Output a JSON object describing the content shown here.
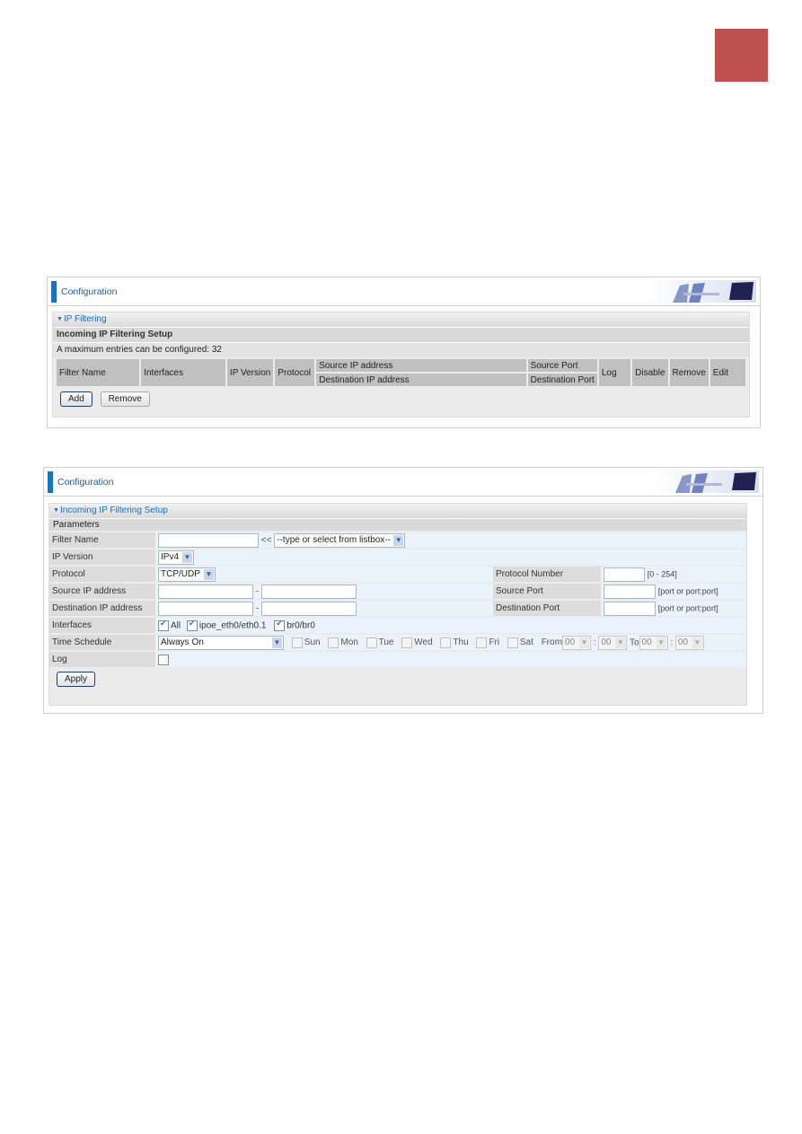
{
  "colors": {
    "accent": "#1276c3",
    "red_tab": "#c0504d",
    "title_blue": "#1a5fa0"
  },
  "panel1": {
    "header_title": "Configuration",
    "banner_icon": "office-chairs-monitor-banner",
    "section_title": "IP Filtering",
    "subtitle": "Incoming IP Filtering Setup",
    "max_entries_text": "A maximum entries can be configured: 32",
    "columns": {
      "filter_name": "Filter Name",
      "interfaces": "Interfaces",
      "ip_version": "IP Version",
      "protocol": "Protocol",
      "source_ip": "Source IP address",
      "destination_ip": "Destination IP address",
      "source_port": "Source Port",
      "destination_port": "Destination Port",
      "log": "Log",
      "disable": "Disable",
      "remove": "Remove",
      "edit": "Edit"
    },
    "buttons": {
      "add": "Add",
      "remove": "Remove"
    }
  },
  "panel2": {
    "header_title": "Configuration",
    "section_title": "Incoming IP Filtering Setup",
    "params_title": "Parameters",
    "fields": {
      "filter_name": {
        "label": "Filter Name",
        "value": "",
        "arrow": "<<",
        "listbox": "--type or select from listbox--"
      },
      "ip_version": {
        "label": "IP Version",
        "value": "IPv4"
      },
      "protocol": {
        "label": "Protocol",
        "value": "TCP/UDP"
      },
      "protocol_number": {
        "label": "Protocol Number",
        "value": "",
        "hint": "[0 - 254]"
      },
      "source_ip": {
        "label": "Source IP address",
        "from": "",
        "sep": "-",
        "to": ""
      },
      "source_port": {
        "label": "Source Port",
        "value": "",
        "hint": "[port or port:port]"
      },
      "destination_ip": {
        "label": "Destination IP address",
        "from": "",
        "sep": "-",
        "to": ""
      },
      "destination_port": {
        "label": "Destination Port",
        "value": "",
        "hint": "[port or port:port]"
      },
      "interfaces": {
        "label": "Interfaces",
        "options": [
          {
            "label": "All",
            "checked": true
          },
          {
            "label": "ipoe_eth0/eth0.1",
            "checked": true
          },
          {
            "label": "br0/br0",
            "checked": true
          }
        ]
      },
      "time_schedule": {
        "label": "Time Schedule",
        "value": "Always On",
        "days": [
          {
            "label": "Sun",
            "checked": false
          },
          {
            "label": "Mon",
            "checked": false
          },
          {
            "label": "Tue",
            "checked": false
          },
          {
            "label": "Wed",
            "checked": false
          },
          {
            "label": "Thu",
            "checked": false
          },
          {
            "label": "Fri",
            "checked": false
          },
          {
            "label": "Sat",
            "checked": false
          }
        ],
        "from_label": "From",
        "from_hour": "00",
        "from_min": "00",
        "to_label": "To",
        "to_hour": "00",
        "to_min": "00",
        "colon": ":"
      },
      "log": {
        "label": "Log",
        "checked": false
      }
    },
    "buttons": {
      "apply": "Apply"
    }
  }
}
